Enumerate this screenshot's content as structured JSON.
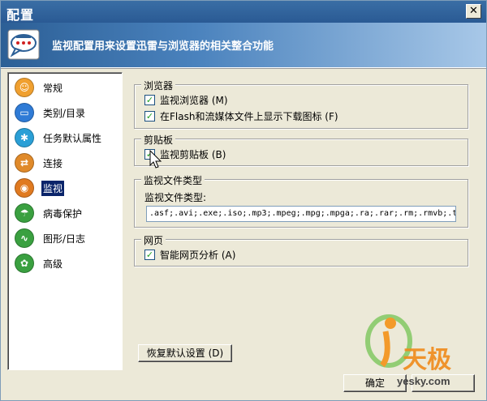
{
  "window": {
    "title": "配置"
  },
  "banner": {
    "text": "监视配置用来设置迅雷与浏览器的相关整合功能"
  },
  "nav": {
    "items": [
      {
        "label": "常规",
        "icon": "person-icon",
        "color": "#f0a030"
      },
      {
        "label": "类别/目录",
        "icon": "folder-icon",
        "color": "#2f7bd6"
      },
      {
        "label": "任务默认属性",
        "icon": "gear-icon",
        "color": "#2a9fd6"
      },
      {
        "label": "连接",
        "icon": "connection-icon",
        "color": "#e08a2a"
      },
      {
        "label": "监视",
        "icon": "monitor-icon",
        "color": "#e07a20",
        "selected": true
      },
      {
        "label": "病毒保护",
        "icon": "umbrella-icon",
        "color": "#3aa040"
      },
      {
        "label": "图形/日志",
        "icon": "graph-icon",
        "color": "#3aa040"
      },
      {
        "label": "高级",
        "icon": "advanced-icon",
        "color": "#3aa040"
      }
    ]
  },
  "browser_group": {
    "title": "浏览器",
    "monitor_browser": {
      "label": "监视浏览器 (M)",
      "checked": true
    },
    "show_flash_icon": {
      "label": "在Flash和流媒体文件上显示下载图标 (F)",
      "checked": true
    }
  },
  "clipboard_group": {
    "title": "剪贴板",
    "monitor_clipboard": {
      "label": "监视剪贴板 (B)",
      "checked": true
    }
  },
  "filetype_group": {
    "title": "监视文件类型",
    "label": "监视文件类型:",
    "value": ".asf;.avi;.exe;.iso;.mp3;.mpeg;.mpg;.mpga;.ra;.rar;.rm;.rmvb;.t"
  },
  "webpage_group": {
    "title": "网页",
    "smart_analysis": {
      "label": "智能网页分析 (A)",
      "checked": true
    }
  },
  "buttons": {
    "restore_defaults": "恢复默认设置 (D)",
    "ok": "确定"
  },
  "watermark": {
    "brand": "天极",
    "url": "yesky.com"
  }
}
